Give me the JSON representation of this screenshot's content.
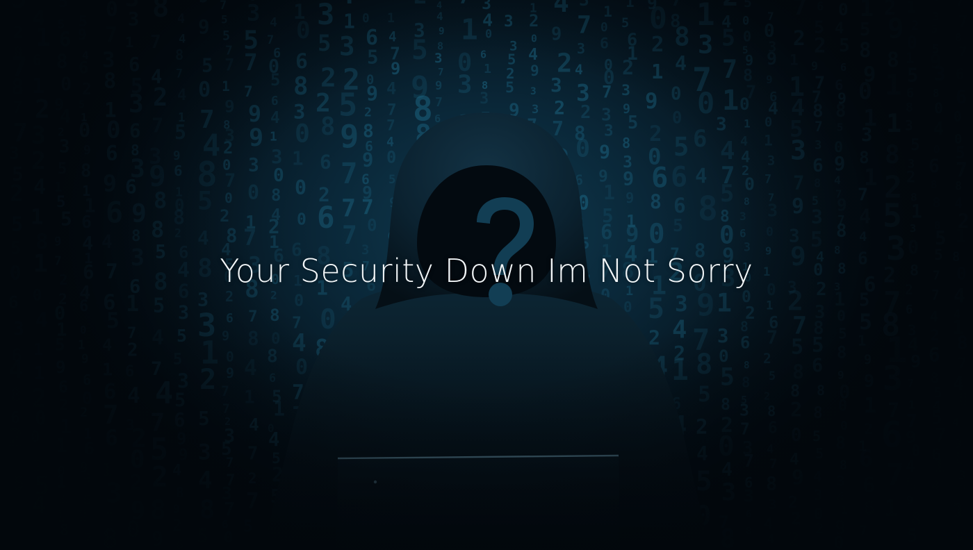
{
  "caption": "Your Security Down Im Not Sorry",
  "icons": {
    "question_mark": "question-mark-icon",
    "laptop": "laptop-icon"
  },
  "colors": {
    "background": "#02070c",
    "glow": "#0f3a4f",
    "digits": "#1f6f8e",
    "question_mark": "#123e54",
    "hood": "#0b2230",
    "laptop_edge": "#7fb7cf",
    "caption": "#f2f6f8"
  }
}
